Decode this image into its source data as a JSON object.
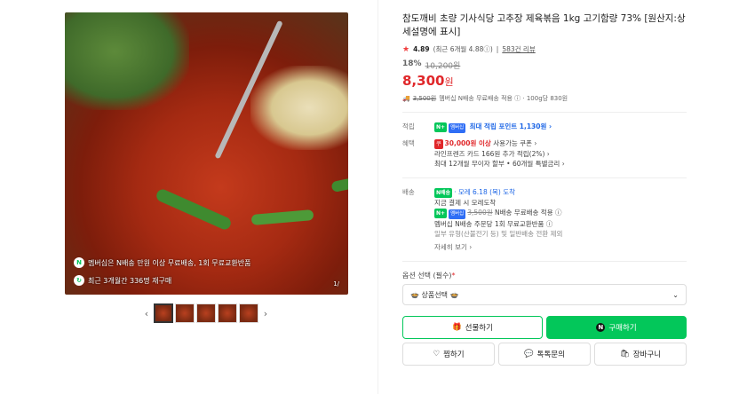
{
  "gallery": {
    "overlay_shipping": "멤버십은 N배송 만원 이상 무료배송, 1회 무료교환반품",
    "overlay_repurchase": "최근 3개월간 336명 재구매",
    "page_indicator": "1/"
  },
  "product": {
    "title": "참도깨비 초량 기사식당 고추장 제육볶음 1kg 고기함량 73% [원산지:상세설명에 표시]",
    "rating": "4.89",
    "rating_detail": "(최근 6개월 4.88ⓘ)",
    "reviews": "583건 리뷰",
    "discount_pct": "18%",
    "original_price": "10,200원",
    "price": "8,300",
    "price_unit": "원",
    "ship_strike": "3,500원",
    "ship_text": "멤버십 N배송 무료배송 적용 ⓘ · 100g당 830원"
  },
  "benefits": {
    "points_label": "적립",
    "points_badge": "N+",
    "points_badge2": "멤버십",
    "points_text": "최대 적립 포인트 1,130원 ›",
    "benefit_label": "혜택",
    "coupon_badge": "쿠",
    "coupon_bold": "30,000원 이상",
    "coupon_text": "사용가능 쿠폰 ›",
    "card_line": "라인프렌즈 카드 166원 추가 적립(2%) ›",
    "installment_line": "최대 12개월 무이자 할부 • 60개월 특별금리 ›"
  },
  "delivery": {
    "label": "배송",
    "badge": "N배송",
    "arrival": "· 모레 6.18 (목) 도착",
    "order_now": "지금 결제 시 모레도착",
    "member_strike": "3,500원",
    "member_text": "N배송 무료배송 적용 ⓘ",
    "exchange": "멤버십 N배송 주문당 1회 무료교환반품 ⓘ",
    "exclusion": "일부 유형(산불전기 등) 및 일반배송 전환 제외",
    "more": "자세히 보기 ›"
  },
  "options": {
    "label": "옵션 선택 (필수)",
    "required_mark": "*",
    "select_value": "🍲 상품선택 🍲"
  },
  "buttons": {
    "gift": "선물하기",
    "buy": "구매하기",
    "wish": "찜하기",
    "talk": "톡톡문의",
    "cart": "장바구니"
  },
  "colors": {
    "accent": "#03c75a",
    "price": "#e0272a"
  }
}
